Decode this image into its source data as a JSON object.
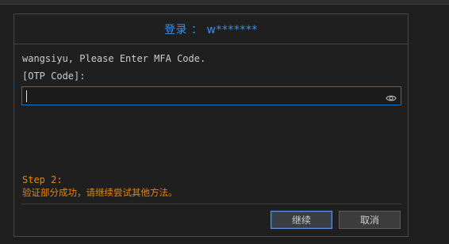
{
  "dialog": {
    "title": "登录 ： w*******",
    "prompt_line_1": "wangsiyu, Please Enter MFA Code.",
    "prompt_line_2": "[OTP Code]:",
    "otp_input": {
      "value": "",
      "placeholder": ""
    },
    "step_title": "Step 2:",
    "step_message": "验证部分成功，请继续尝试其他方法。",
    "buttons": {
      "continue_label": "继续",
      "cancel_label": "取消"
    }
  },
  "colors": {
    "title": "#3b8eea",
    "accent_border": "#0e74c7",
    "warning_text": "#e5850b",
    "background": "#1f1f1f"
  },
  "icons": {
    "password_toggle": "eye-icon"
  }
}
